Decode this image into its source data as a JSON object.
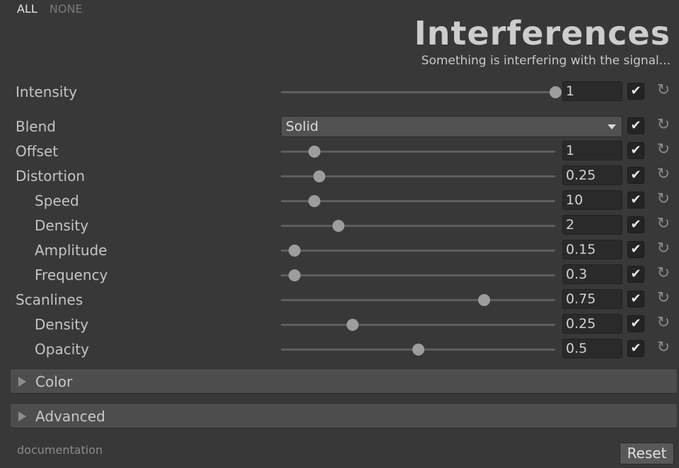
{
  "toggles": {
    "all": "ALL",
    "none": "NONE"
  },
  "header": {
    "title": "Interferences",
    "subtitle": "Something is interfering with the signal..."
  },
  "intensity": {
    "label": "Intensity",
    "value": "1",
    "level": 1.0,
    "checked": true
  },
  "blend": {
    "label": "Blend",
    "value": "Solid",
    "checked": true
  },
  "params": [
    {
      "label": "Offset",
      "value": "1",
      "level": 0.12,
      "indent": 0,
      "checked": true
    },
    {
      "label": "Distortion",
      "value": "0.25",
      "level": 0.14,
      "indent": 0,
      "checked": true
    },
    {
      "label": "Speed",
      "value": "10",
      "level": 0.12,
      "indent": 1,
      "checked": true
    },
    {
      "label": "Density",
      "value": "2",
      "level": 0.21,
      "indent": 1,
      "checked": true
    },
    {
      "label": "Amplitude",
      "value": "0.15",
      "level": 0.05,
      "indent": 1,
      "checked": true
    },
    {
      "label": "Frequency",
      "value": "0.3",
      "level": 0.05,
      "indent": 1,
      "checked": true
    },
    {
      "label": "Scanlines",
      "value": "0.75",
      "level": 0.74,
      "indent": 0,
      "checked": true
    },
    {
      "label": "Density",
      "value": "0.25",
      "level": 0.26,
      "indent": 1,
      "checked": true
    },
    {
      "label": "Opacity",
      "value": "0.5",
      "level": 0.5,
      "indent": 1,
      "checked": true
    }
  ],
  "foldouts": {
    "color": "Color",
    "advanced": "Advanced"
  },
  "footer": {
    "documentation": "documentation",
    "reset": "Reset"
  },
  "icons": {
    "check": "check-icon",
    "reset": "reset-icon",
    "dropdown": "chevron-down-icon",
    "foldout": "triangle-right-icon"
  }
}
